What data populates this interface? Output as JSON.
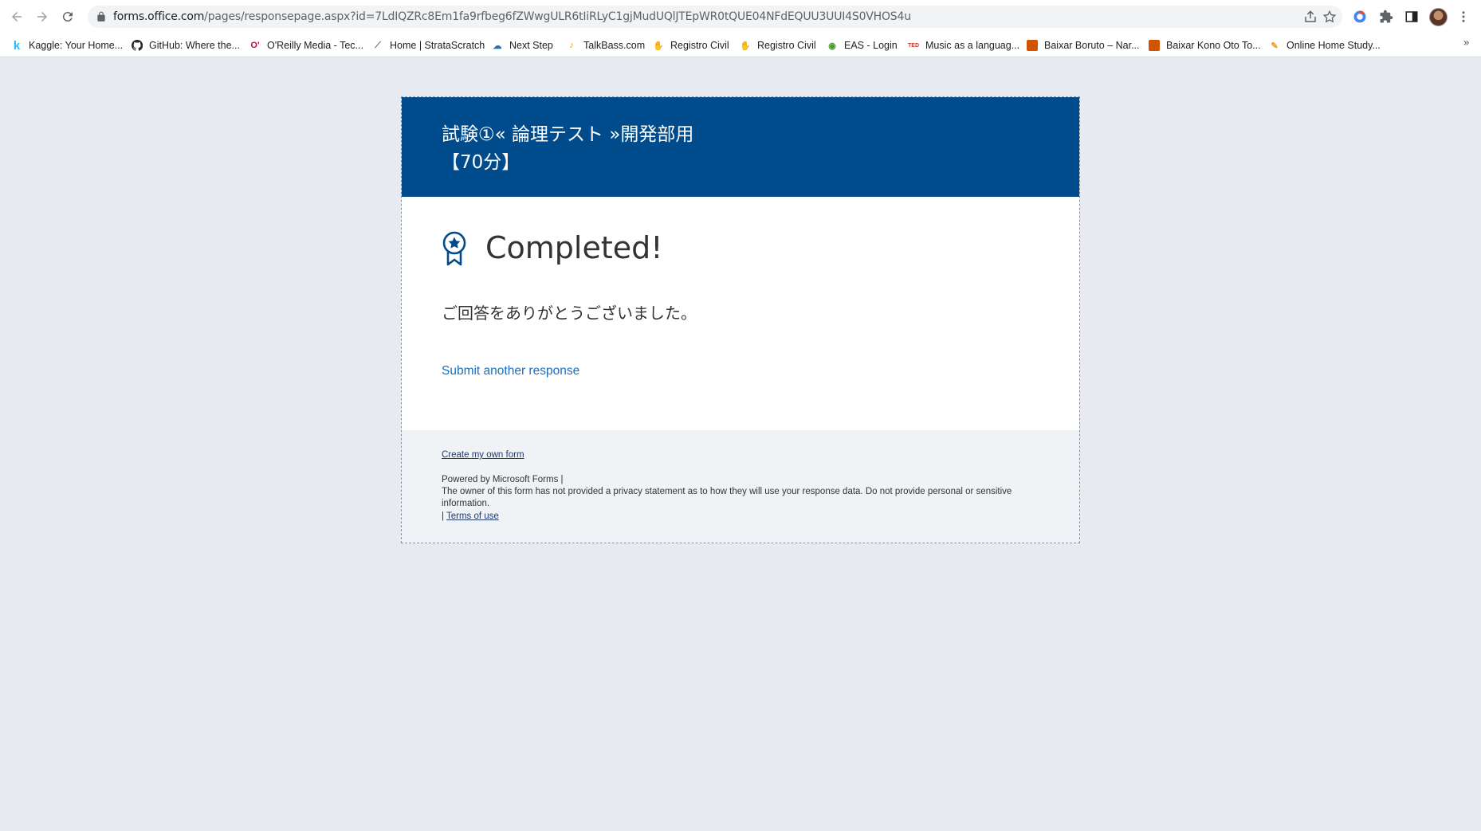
{
  "browser": {
    "url_host": "forms.office.com",
    "url_path": "/pages/responsepage.aspx?id=7LdIQZRc8Em1fa9rfbeg6fZWwgULR6tIiRLyC1gjMudUQlJTEpWR0tQUE04NFdEQUU3UUI4S0VHOS4u",
    "bookmarks": [
      {
        "label": "Kaggle: Your Home...",
        "icon": "kaggle-icon",
        "color": "#20beff",
        "glyph": "k"
      },
      {
        "label": "GitHub: Where the...",
        "icon": "github-icon",
        "color": "#24292e",
        "glyph": "●"
      },
      {
        "label": "O'Reilly Media - Tec...",
        "icon": "oreilly-icon",
        "color": "#d3002d",
        "glyph": "O"
      },
      {
        "label": "Home | StrataScratch",
        "icon": "stratascratch-icon",
        "color": "#5f6b7a",
        "glyph": "⟋"
      },
      {
        "label": "Next Step",
        "icon": "nextstep-icon",
        "color": "#2b6cb0",
        "glyph": "☁"
      },
      {
        "label": "TalkBass.com",
        "icon": "talkbass-icon",
        "color": "#e6a400",
        "glyph": "𝄢"
      },
      {
        "label": "Registro Civil",
        "icon": "registro-civil-icon",
        "color": "#b5a642",
        "glyph": "✋"
      },
      {
        "label": "Registro Civil",
        "icon": "registro-civil-icon",
        "color": "#b5a642",
        "glyph": "✋"
      },
      {
        "label": "EAS - Login",
        "icon": "eas-icon",
        "color": "#4a9a2a",
        "glyph": "◉"
      },
      {
        "label": "Music as a languag...",
        "icon": "music-icon",
        "color": "#c0392b",
        "glyph": "ᵗᵉᵈ"
      },
      {
        "label": "Baixar Boruto – Nar...",
        "icon": "baixar-icon",
        "color": "#d35400",
        "glyph": "▣"
      },
      {
        "label": "Baixar Kono Oto To...",
        "icon": "baixar-icon",
        "color": "#d35400",
        "glyph": "▣"
      },
      {
        "label": "Online Home Study...",
        "icon": "study-icon",
        "color": "#f39c12",
        "glyph": "✎"
      }
    ],
    "more": "»"
  },
  "form": {
    "title": "試験①« 論理テスト »開発部用\n【70分】",
    "completed_label": "Completed!",
    "thanks_message": "ご回答をありがとうございました。",
    "submit_another_label": "Submit another response",
    "footer": {
      "create_form_label": "Create my own form",
      "powered_by": "Powered by Microsoft Forms |",
      "privacy_notice": "The owner of this form has not provided a privacy statement as to how they will use your response data. Do not provide personal or sensitive information.",
      "separator": "|",
      "terms_label": "Terms of use"
    }
  },
  "colors": {
    "header_bg": "#004b8b",
    "page_bg": "#e7ebf1",
    "link": "#1b6ec2"
  }
}
